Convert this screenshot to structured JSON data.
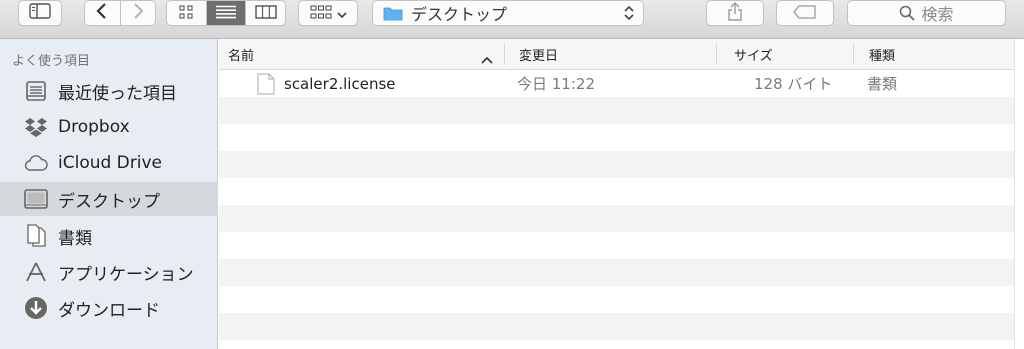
{
  "toolbar": {
    "location": "デスクトップ",
    "search_placeholder": "検索"
  },
  "sidebar": {
    "section_title": "よく使う項目",
    "items": [
      {
        "label": "最近使った項目",
        "icon": "recent-items-icon"
      },
      {
        "label": "Dropbox",
        "icon": "dropbox-icon"
      },
      {
        "label": "iCloud Drive",
        "icon": "cloud-icon"
      },
      {
        "label": "デスクトップ",
        "icon": "desktop-icon",
        "selected": true
      },
      {
        "label": "書類",
        "icon": "documents-icon"
      },
      {
        "label": "アプリケーション",
        "icon": "applications-icon"
      },
      {
        "label": "ダウンロード",
        "icon": "downloads-icon"
      }
    ]
  },
  "columns": {
    "name": "名前",
    "modified": "変更日",
    "size": "サイズ",
    "kind": "種類"
  },
  "files": [
    {
      "name": "scaler2.license",
      "modified": "今日 11:22",
      "size": "128 バイト",
      "kind": "書類"
    }
  ]
}
